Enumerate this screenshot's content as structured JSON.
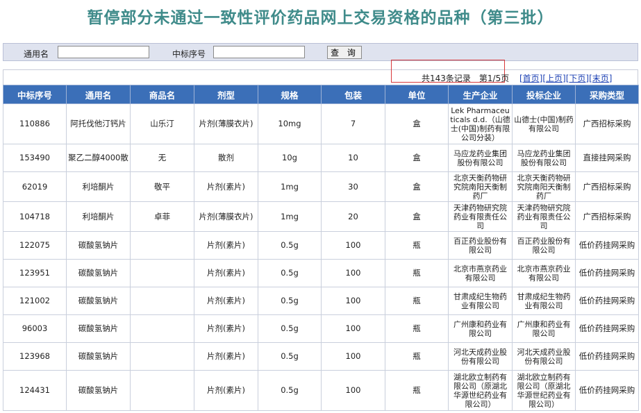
{
  "title": "暂停部分未通过一致性评价药品网上交易资格的品种（第三批）",
  "search": {
    "generic_label": "通用名",
    "bid_no_label": "中标序号",
    "generic_value": "",
    "bid_no_value": "",
    "query_label": "查 询"
  },
  "pager": {
    "total_text": "共143条记录　第1/5页",
    "first": "[首页]",
    "prev": "[上页]",
    "next": "[下页]",
    "last": "[末页]"
  },
  "table": {
    "headers": [
      "中标序号",
      "通用名",
      "商品名",
      "剂型",
      "规格",
      "包装",
      "单位",
      "生产企业",
      "投标企业",
      "采购类型"
    ],
    "rows": [
      [
        "110886",
        "阿托伐他汀钙片",
        "山乐汀",
        "片剂(薄膜衣片)",
        "10mg",
        "7",
        "盒",
        "Lek Pharmaceuticals d.d.（山德士(中国)制药有限公司分装）",
        "山德士(中国)制药有限公司",
        "广西招标采购"
      ],
      [
        "153490",
        "聚乙二醇4000散",
        "无",
        "散剂",
        "10g",
        "10",
        "盒",
        "马应龙药业集团股份有限公司",
        "马应龙药业集团股份有限公司",
        "直接挂网采购"
      ],
      [
        "62019",
        "利培酮片",
        "敬平",
        "片剂(素片)",
        "1mg",
        "30",
        "盒",
        "北京天衡药物研究院南阳天衡制药厂",
        "北京天衡药物研究院南阳天衡制药厂",
        "广西招标采购"
      ],
      [
        "104718",
        "利培酮片",
        "卓菲",
        "片剂(薄膜衣片)",
        "1mg",
        "20",
        "盒",
        "天津药物研究院药业有限责任公司",
        "天津药物研究院药业有限责任公司",
        "广西招标采购"
      ],
      [
        "122075",
        "碳酸氢钠片",
        "",
        "片剂(素片)",
        "0.5g",
        "100",
        "瓶",
        "百正药业股份有限公司",
        "百正药业股份有限公司",
        "低价药挂网采购"
      ],
      [
        "123951",
        "碳酸氢钠片",
        "",
        "片剂(素片)",
        "0.5g",
        "100",
        "瓶",
        "北京市燕京药业有限公司",
        "北京市燕京药业有限公司",
        "低价药挂网采购"
      ],
      [
        "121002",
        "碳酸氢钠片",
        "",
        "片剂(素片)",
        "0.5g",
        "100",
        "瓶",
        "甘肃成纪生物药业有限公司",
        "甘肃成纪生物药业有限公司",
        "低价药挂网采购"
      ],
      [
        "96003",
        "碳酸氢钠片",
        "",
        "片剂(素片)",
        "0.5g",
        "100",
        "瓶",
        "广州康和药业有限公司",
        "广州康和药业有限公司",
        "低价药挂网采购"
      ],
      [
        "123968",
        "碳酸氢钠片",
        "",
        "片剂(素片)",
        "0.5g",
        "100",
        "瓶",
        "河北天成药业股份有限公司",
        "河北天成药业股份有限公司",
        "低价药挂网采购"
      ],
      [
        "124431",
        "碳酸氢钠片",
        "",
        "片剂(素片)",
        "0.5g",
        "100",
        "瓶",
        "湖北欧立制药有限公司（原湖北华源世纪药业有限公司）",
        "湖北欧立制药有限公司（原湖北华源世纪药业有限公司）",
        "低价药挂网采购"
      ]
    ]
  }
}
